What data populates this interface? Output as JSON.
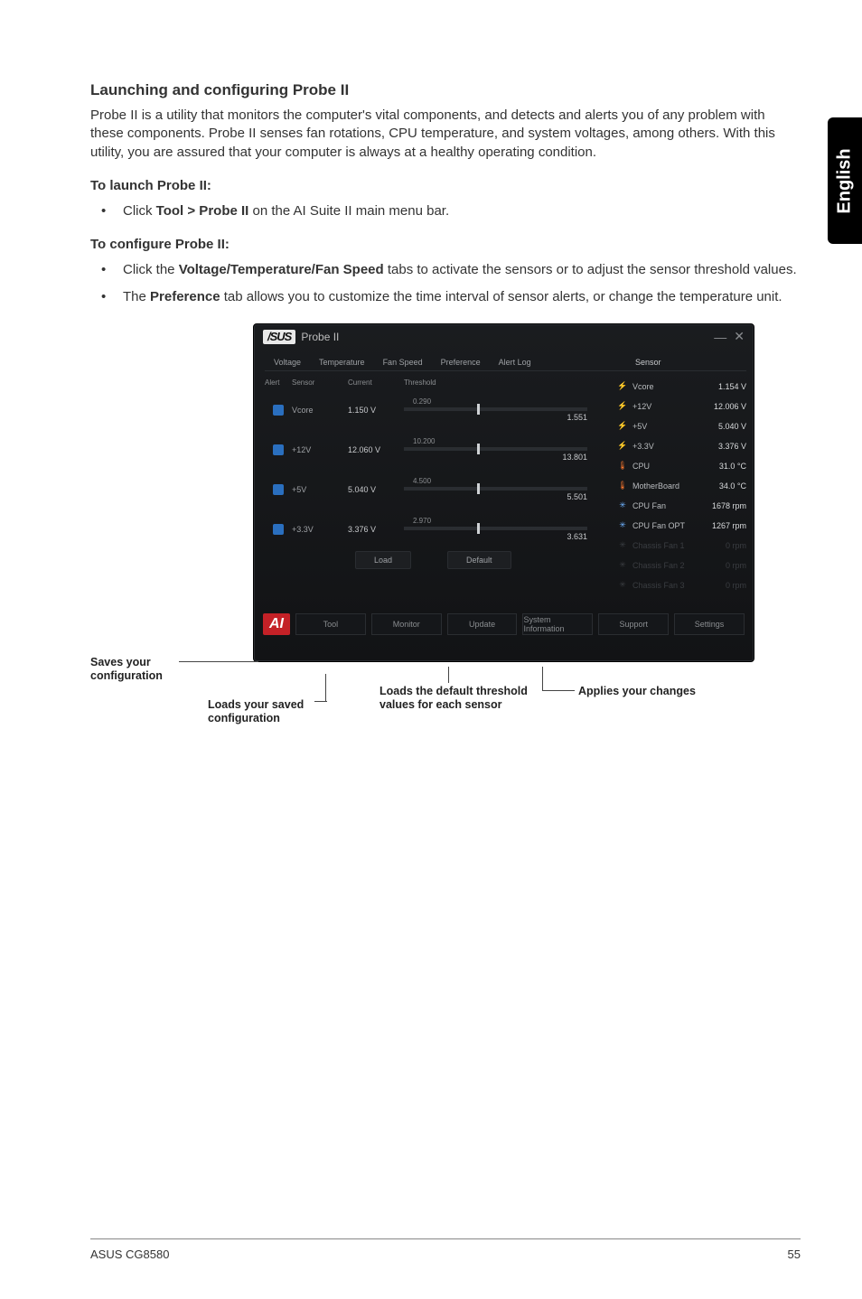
{
  "sideTab": "English",
  "heading": "Launching and configuring Probe II",
  "intro": "Probe II is a utility that monitors the computer's vital components, and detects and alerts you of any problem with these components. Probe II senses fan rotations, CPU temperature, and system voltages, among others. With this utility, you are assured that your computer is always at a healthy operating condition.",
  "launch": {
    "title": "To launch Probe II:",
    "item_pre": "Click ",
    "item_bold": "Tool > Probe II",
    "item_post": " on the AI Suite II main menu bar."
  },
  "config": {
    "title": "To configure Probe II:",
    "i1_pre": "Click the ",
    "i1_bold": "Voltage/Temperature/Fan Speed",
    "i1_post": " tabs to activate the sensors or to adjust the sensor threshold values.",
    "i2_pre": "The ",
    "i2_bold": "Preference",
    "i2_post": " tab allows you to customize the time interval of sensor alerts, or change the temperature unit."
  },
  "app": {
    "brand": "/SUS",
    "title": "Probe II",
    "tabs": {
      "voltage": "Voltage",
      "temperature": "Temperature",
      "fanspeed": "Fan Speed",
      "preference": "Preference",
      "alertlog": "Alert Log",
      "sensor": "Sensor"
    },
    "cols": {
      "alert": "Alert",
      "sensor": "Sensor",
      "current": "Current",
      "threshold": "Threshold"
    },
    "rows": [
      {
        "sensor": "Vcore",
        "current": "1.150 V",
        "tval": "0.290",
        "rval": "1.551"
      },
      {
        "sensor": "+12V",
        "current": "12.060 V",
        "tval": "10.200",
        "rval": "13.801"
      },
      {
        "sensor": "+5V",
        "current": "5.040 V",
        "tval": "4.500",
        "rval": "5.501"
      },
      {
        "sensor": "+3.3V",
        "current": "3.376 V",
        "tval": "2.970",
        "rval": "3.631"
      }
    ],
    "buttons": {
      "load": "Load",
      "default": "Default"
    },
    "sensors": [
      {
        "ic": "bolt",
        "name": "Vcore",
        "val": "1.154 V"
      },
      {
        "ic": "bolt",
        "name": "+12V",
        "val": "12.006 V"
      },
      {
        "ic": "bolt",
        "name": "+5V",
        "val": "5.040 V"
      },
      {
        "ic": "bolt",
        "name": "+3.3V",
        "val": "3.376 V"
      },
      {
        "ic": "temp",
        "name": "CPU",
        "val": "31.0 °C"
      },
      {
        "ic": "temp",
        "name": "MotherBoard",
        "val": "34.0 °C"
      },
      {
        "ic": "fan",
        "name": "CPU Fan",
        "val": "1678 rpm"
      },
      {
        "ic": "fan",
        "name": "CPU Fan OPT",
        "val": "1267 rpm"
      },
      {
        "ic": "dim",
        "name": "Chassis Fan 1",
        "val": "0 rpm",
        "muted": true
      },
      {
        "ic": "dim",
        "name": "Chassis Fan 2",
        "val": "0 rpm",
        "muted": true
      },
      {
        "ic": "dim",
        "name": "Chassis Fan 3",
        "val": "0 rpm",
        "muted": true
      }
    ],
    "status": {
      "tool": "Tool",
      "monitor": "Monitor",
      "update": "Update",
      "sysinfo": "System Information",
      "support": "Support",
      "settings": "Settings"
    }
  },
  "callouts": {
    "save": "Saves your configuration",
    "loadsaved": "Loads your saved configuration",
    "defaults": "Loads the default threshold values for each sensor",
    "apply": "Applies your changes"
  },
  "footer": {
    "left": "ASUS CG8580",
    "right": "55"
  }
}
